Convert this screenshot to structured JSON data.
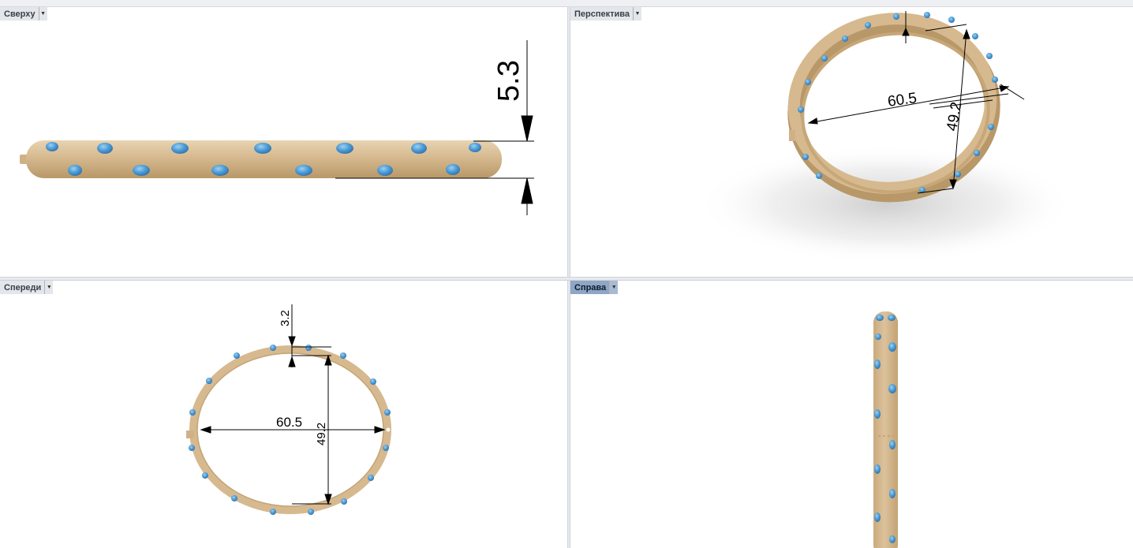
{
  "viewports": {
    "top": {
      "label": "Сверху",
      "dimension": "5.3"
    },
    "perspective": {
      "label": "Перспектива",
      "dim_width": "60.5",
      "dim_height": "49.2"
    },
    "front": {
      "label": "Спереди",
      "dim_thickness": "3.2",
      "dim_width": "60.5",
      "dim_height": "49.2"
    },
    "right": {
      "label": "Справа",
      "active": true
    }
  },
  "colors": {
    "metal": "#d6b98f",
    "metal_shade": "#b89868",
    "gem": "#4f9ed8",
    "gem_dark": "#2f6fa8",
    "active_tab": "#8fa6c4"
  },
  "icons": {
    "viewport_menu": "triangle-down-icon"
  }
}
